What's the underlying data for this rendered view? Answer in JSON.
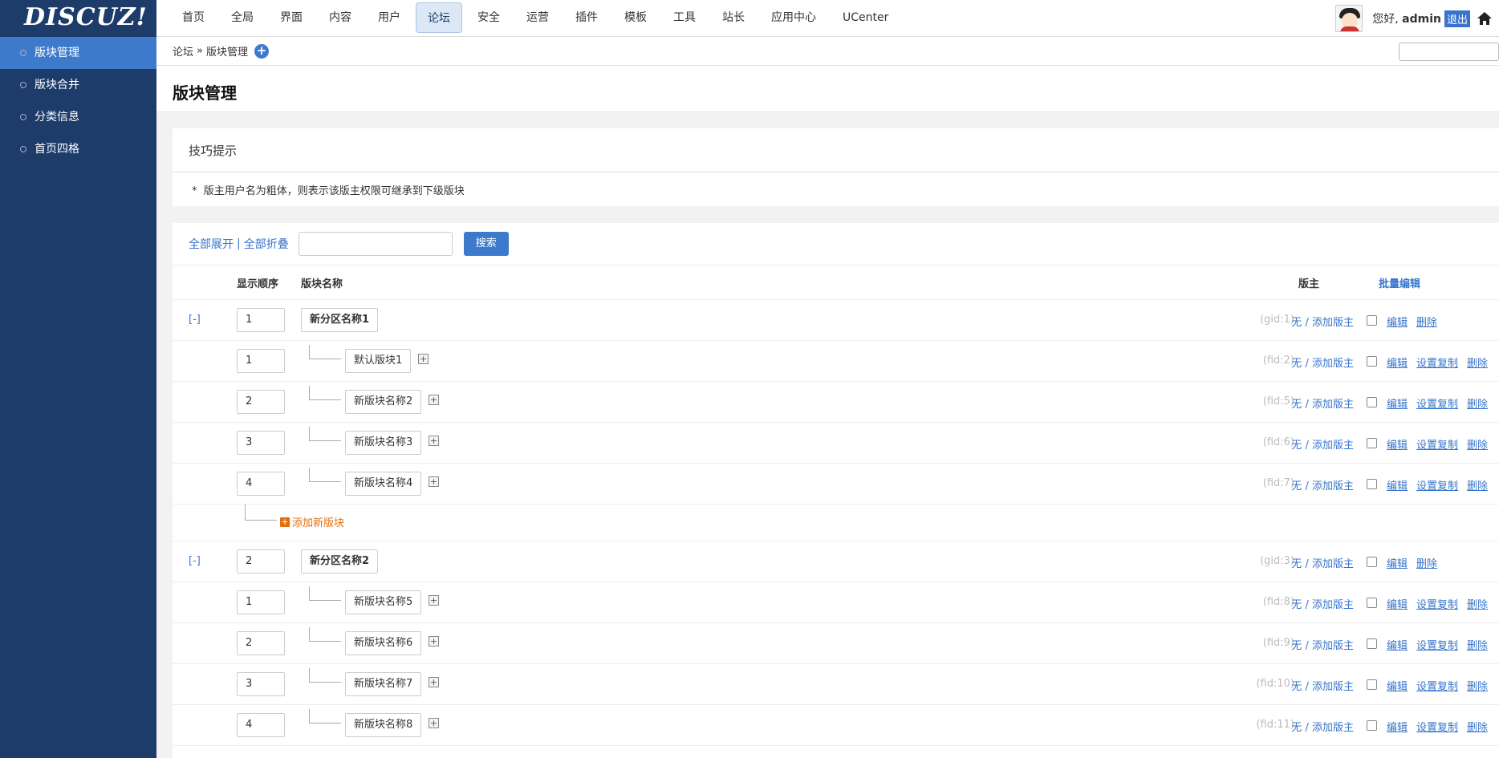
{
  "app": {
    "logo": "DISCUZ!"
  },
  "nav": [
    "首页",
    "全局",
    "界面",
    "内容",
    "用户",
    "论坛",
    "安全",
    "运营",
    "插件",
    "模板",
    "工具",
    "站长",
    "应用中心",
    "UCenter"
  ],
  "nav_active": "论坛",
  "user": {
    "hello": "您好,",
    "name": "admin",
    "logout": "退出"
  },
  "sidebar": [
    {
      "label": "版块管理",
      "active": true
    },
    {
      "label": "版块合并",
      "active": false
    },
    {
      "label": "分类信息",
      "active": false
    },
    {
      "label": "首页四格",
      "active": false
    }
  ],
  "breadcrumb": {
    "parent": "论坛",
    "sep": "»",
    "current": "版块管理",
    "add_icon": "+"
  },
  "page_title": "版块管理",
  "tips": {
    "title": "技巧提示",
    "bullet": "*",
    "text": "版主用户名为粗体，则表示该版主权限可继承到下级版块"
  },
  "toolbar": {
    "expand_all": "全部展开",
    "sep": "|",
    "collapse_all": "全部折叠",
    "search_button": "搜索"
  },
  "table_head": {
    "order": "显示顺序",
    "name": "版块名称",
    "moderator": "版主",
    "batch_edit": "批量编辑"
  },
  "common": {
    "no_mod": "无",
    "slash": "/",
    "add_mod": "添加版主",
    "edit": "编辑",
    "copy": "设置复制",
    "delete": "删除",
    "collapse": "[-]",
    "add_forum": "添加新版块",
    "plus": "+"
  },
  "groups": [
    {
      "order": "1",
      "name": "新分区名称1",
      "id": "(gid:1)",
      "forums": [
        {
          "order": "1",
          "name": "默认版块1",
          "id": "(fid:2)"
        },
        {
          "order": "2",
          "name": "新版块名称2",
          "id": "(fid:5)"
        },
        {
          "order": "3",
          "name": "新版块名称3",
          "id": "(fid:6)"
        },
        {
          "order": "4",
          "name": "新版块名称4",
          "id": "(fid:7)"
        }
      ]
    },
    {
      "order": "2",
      "name": "新分区名称2",
      "id": "(gid:3)",
      "forums": [
        {
          "order": "1",
          "name": "新版块名称5",
          "id": "(fid:8)"
        },
        {
          "order": "2",
          "name": "新版块名称6",
          "id": "(fid:9)"
        },
        {
          "order": "3",
          "name": "新版块名称7",
          "id": "(fid:10)"
        },
        {
          "order": "4",
          "name": "新版块名称8",
          "id": "(fid:11)"
        }
      ]
    }
  ],
  "colors": {
    "sidebar": "#1d3c6a",
    "accent": "#3e7acb",
    "link": "#3775cc",
    "add": "#e56c0a"
  }
}
